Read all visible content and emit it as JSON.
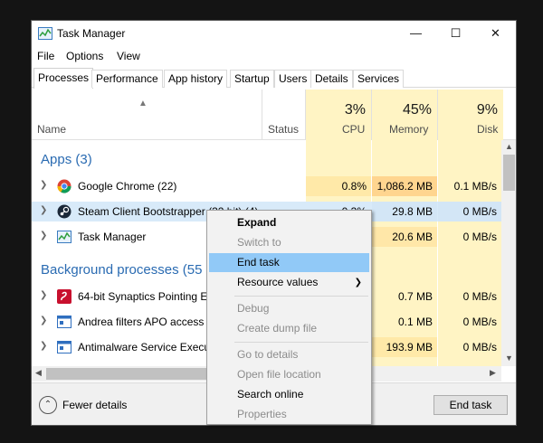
{
  "window": {
    "title": "Task Manager",
    "minimize_glyph": "—",
    "maximize_glyph": "☐",
    "close_glyph": "✕",
    "app_icon": "task-manager-icon"
  },
  "menu": [
    "File",
    "Options",
    "View"
  ],
  "tabs": [
    "Processes",
    "Performance",
    "App history",
    "Startup",
    "Users",
    "Details",
    "Services"
  ],
  "active_tab": "Processes",
  "header": {
    "name": "Name",
    "status": "Status",
    "cpu_pct": "3%",
    "cpu": "CPU",
    "memory_pct": "45%",
    "memory": "Memory",
    "disk_pct": "9%",
    "disk": "Disk"
  },
  "groups": {
    "apps": "Apps (3)",
    "background": "Background processes (55"
  },
  "apps": [
    {
      "name": "Google Chrome (22)",
      "cpu": "0.8%",
      "memory": "1,086.2 MB",
      "disk": "0.1 MB/s",
      "icon": "chrome-icon"
    },
    {
      "name": "Steam Client Bootstrapper (32 bit) (4)",
      "cpu": "0.3%",
      "memory": "29.8 MB",
      "disk": "0 MB/s",
      "icon": "steam-icon"
    },
    {
      "name": "Task Manager",
      "cpu": "",
      "memory": "20.6 MB",
      "disk": "0 MB/s",
      "icon": "task-manager-icon"
    }
  ],
  "background": [
    {
      "name": "64-bit Synaptics Pointing E",
      "cpu": "",
      "memory": "0.7 MB",
      "disk": "0 MB/s",
      "icon": "synaptics-icon"
    },
    {
      "name": "Andrea filters APO access s",
      "cpu": "",
      "memory": "0.1 MB",
      "disk": "0 MB/s",
      "icon": "window-icon"
    },
    {
      "name": "Antimalware Service Execut",
      "cpu": "",
      "memory": "193.9 MB",
      "disk": "0 MB/s",
      "icon": "window-icon"
    }
  ],
  "footer": {
    "fewer_details": "Fewer details",
    "end_task": "End task"
  },
  "context_menu": {
    "expand": "Expand",
    "switch_to": "Switch to",
    "end_task": "End task",
    "resource_values": "Resource values",
    "debug": "Debug",
    "create_dump": "Create dump file",
    "go_to_details": "Go to details",
    "open_file_location": "Open file location",
    "search_online": "Search online",
    "properties": "Properties"
  },
  "colors": {
    "group_title": "#2a6bb2",
    "cpu_bg": "#fff4c4",
    "memory_high_bg": "#ffd58f",
    "memory_mid_bg": "#ffe7a8",
    "selection": "#d8eaf9",
    "menu_highlight": "#91c9f7"
  }
}
